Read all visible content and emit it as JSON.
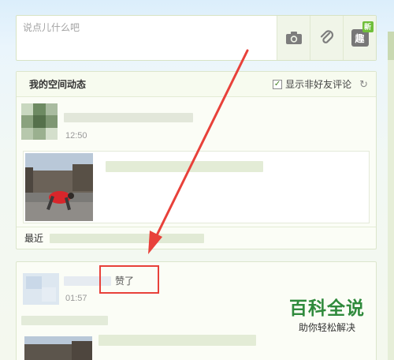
{
  "composer": {
    "placeholder": "说点儿什么吧",
    "tools": [
      {
        "name": "photo",
        "icon": "camera-icon"
      },
      {
        "name": "link",
        "icon": "paperclip-icon"
      },
      {
        "name": "fun",
        "icon": "qu-icon",
        "glyph": "趣",
        "badge": "新"
      }
    ]
  },
  "feed": {
    "title": "我的空间动态",
    "show_nonfriend_label": "显示非好友评论",
    "show_nonfriend_checked": true,
    "post": {
      "time": "12:50",
      "recent_prefix": "最近"
    }
  },
  "feed2": {
    "liked_text": "赞了",
    "time": "01:57"
  },
  "watermark": {
    "title": "百科全说",
    "subtitle": "助你轻松解决"
  },
  "colors": {
    "accent_green": "#2f8a3c",
    "highlight_red": "#e8413a",
    "arrow_red": "#e8413a"
  }
}
